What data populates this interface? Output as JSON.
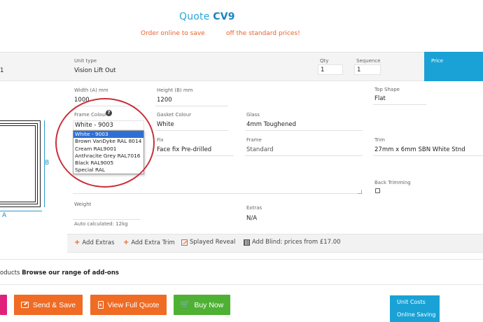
{
  "header": {
    "quote_prefix": "Quote",
    "quote_code": "CV9",
    "promo_left": "Order online to save",
    "promo_right": "off the standard prices!"
  },
  "unit_row": {
    "row_number": "1",
    "unit_type_label": "Unit type",
    "unit_type_value": "Vision Lift Out",
    "qty_label": "Qty",
    "qty_value": "1",
    "sequence_label": "Sequence",
    "sequence_value": "1",
    "price_label": "Price"
  },
  "diagram": {
    "width_marker": "A",
    "height_marker": "B"
  },
  "form": {
    "width_label": "Width (A) mm",
    "width_value": "1000",
    "height_label": "Height (B) mm",
    "height_value": "1200",
    "top_shape_label": "Top Shape",
    "top_shape_value": "Flat",
    "frame_colour_label": "Frame Colour",
    "frame_colour_value": "White - 9003",
    "gasket_colour_label": "Gasket Colour",
    "gasket_colour_value": "White",
    "glass_label": "Glass",
    "glass_value": "4mm Toughened",
    "fix_label": "Fix",
    "fix_value": "Face fix Pre-drilled",
    "frame_label": "Frame",
    "frame_value": "Standard",
    "trim_label": "Trim",
    "trim_value": "27mm x 6mm SBN White Stnd",
    "back_trimming_label": "Back Trimming",
    "weight_label": "Weight",
    "weight_note": "Auto calculated: 12kg",
    "extras_label": "Extras",
    "extras_value": "N/A"
  },
  "frame_colour_options": [
    "White - 9003",
    "Brown VanDyke RAL 8014",
    "Cream RAL9001",
    "Anthracite Grey RAL7016",
    "Black RAL9005",
    "Special RAL"
  ],
  "add_links": {
    "add_extras": "Add Extras",
    "add_extra_trim": "Add Extra Trim",
    "splayed_reveal": "Splayed Reveal",
    "add_blind": "Add Blind: prices from £17.00"
  },
  "products": {
    "prefix": "oducts",
    "link": "Browse our range of add-ons"
  },
  "actions": {
    "send_save": "Send & Save",
    "view_full_quote": "View Full Quote",
    "buy_now": "Buy Now"
  },
  "summary": {
    "unit_costs": "Unit Costs",
    "online_saving": "Online Saving"
  },
  "colors": {
    "accent_blue": "#1aa2d6",
    "orange": "#f06b23",
    "green": "#4fb134",
    "pink": "#e0207a",
    "highlight_ring": "#c9303a"
  },
  "icons": {
    "help": "question-circle-icon",
    "send": "send-icon",
    "doc": "document-icon",
    "cart": "cart-icon",
    "splay": "splayed-reveal-icon",
    "blind": "blind-icon"
  }
}
